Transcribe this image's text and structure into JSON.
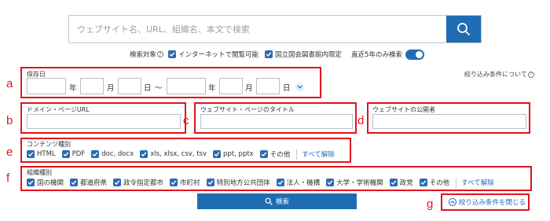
{
  "search": {
    "placeholder": "ウェブサイト名、URL、組織名、本文で検索"
  },
  "target": {
    "label": "検索対象",
    "options": [
      "インターネットで閲覧可能",
      "国立国会図書館内限定"
    ],
    "recent_label": "直近5年のみ検索"
  },
  "markers": [
    "a",
    "b",
    "c",
    "d",
    "e",
    "f",
    "g"
  ],
  "date": {
    "label": "保存日",
    "year": "年",
    "month": "月",
    "day": "日",
    "tilde": "～",
    "help": "絞り込み条件について"
  },
  "fields": {
    "domain": "ドメイン・ページURL",
    "title": "ウェブサイト・ページのタイトル",
    "publisher": "ウェブサイトの公開者"
  },
  "content_types": {
    "label": "コンテンツ種別",
    "items": [
      "HTML",
      "PDF",
      "doc, docx",
      "xls, xlsx, csv, tsv",
      "ppt, pptx",
      "その他"
    ],
    "clear": "すべて解除"
  },
  "org_types": {
    "label": "組織種別",
    "items": [
      "国の機関",
      "都道府県",
      "政令指定都市",
      "市町村",
      "特別地方公共団体",
      "法人・機構",
      "大学・学術機関",
      "政党",
      "その他"
    ],
    "clear": "すべて解除"
  },
  "actions": {
    "search": "検索",
    "close_filters": "絞り込み条件を閉じる"
  },
  "colors": {
    "accent": "#1f6cb4",
    "marker": "#e0141e"
  }
}
